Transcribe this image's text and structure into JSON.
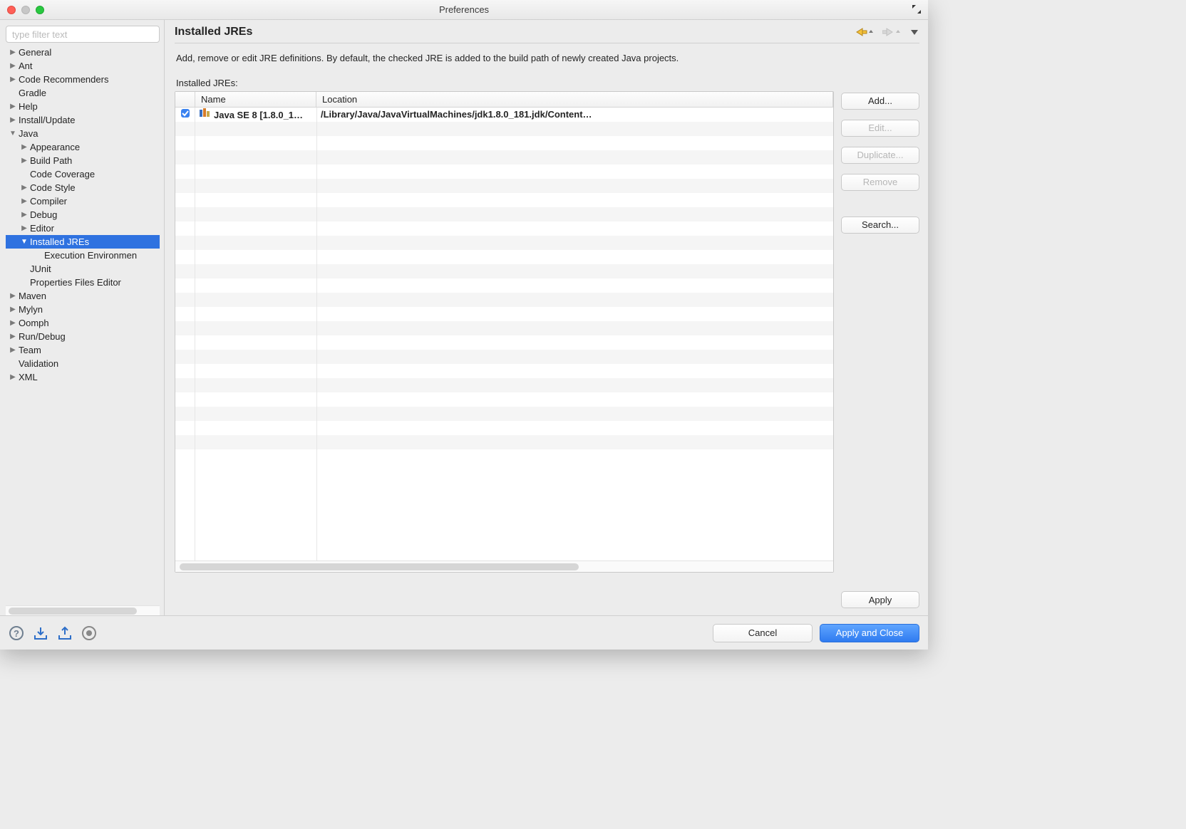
{
  "window": {
    "title": "Preferences"
  },
  "sidebar": {
    "filter_placeholder": "type filter text",
    "items": [
      {
        "label": "General",
        "exp": "▶",
        "indent": 0
      },
      {
        "label": "Ant",
        "exp": "▶",
        "indent": 0
      },
      {
        "label": "Code Recommenders",
        "exp": "▶",
        "indent": 0
      },
      {
        "label": "Gradle",
        "exp": "",
        "indent": 0
      },
      {
        "label": "Help",
        "exp": "▶",
        "indent": 0
      },
      {
        "label": "Install/Update",
        "exp": "▶",
        "indent": 0
      },
      {
        "label": "Java",
        "exp": "▼",
        "indent": 0
      },
      {
        "label": "Appearance",
        "exp": "▶",
        "indent": 1
      },
      {
        "label": "Build Path",
        "exp": "▶",
        "indent": 1
      },
      {
        "label": "Code Coverage",
        "exp": "",
        "indent": 1
      },
      {
        "label": "Code Style",
        "exp": "▶",
        "indent": 1
      },
      {
        "label": "Compiler",
        "exp": "▶",
        "indent": 1
      },
      {
        "label": "Debug",
        "exp": "▶",
        "indent": 1
      },
      {
        "label": "Editor",
        "exp": "▶",
        "indent": 1
      },
      {
        "label": "Installed JREs",
        "exp": "▼",
        "indent": 1,
        "selected": true
      },
      {
        "label": "Execution Environmen",
        "exp": "",
        "indent": 2
      },
      {
        "label": "JUnit",
        "exp": "",
        "indent": 1
      },
      {
        "label": "Properties Files Editor",
        "exp": "",
        "indent": 1
      },
      {
        "label": "Maven",
        "exp": "▶",
        "indent": 0
      },
      {
        "label": "Mylyn",
        "exp": "▶",
        "indent": 0
      },
      {
        "label": "Oomph",
        "exp": "▶",
        "indent": 0
      },
      {
        "label": "Run/Debug",
        "exp": "▶",
        "indent": 0
      },
      {
        "label": "Team",
        "exp": "▶",
        "indent": 0
      },
      {
        "label": "Validation",
        "exp": "",
        "indent": 0
      },
      {
        "label": "XML",
        "exp": "▶",
        "indent": 0
      }
    ]
  },
  "page": {
    "title": "Installed JREs",
    "description": "Add, remove or edit JRE definitions. By default, the checked JRE is added to the build path of newly created Java projects.",
    "table_label": "Installed JREs:",
    "columns": {
      "name": "Name",
      "location": "Location"
    },
    "rows": [
      {
        "checked": true,
        "name": "Java SE 8 [1.8.0_1…",
        "location": "/Library/Java/JavaVirtualMachines/jdk1.8.0_181.jdk/Content…"
      }
    ],
    "buttons": {
      "add": "Add...",
      "edit": "Edit...",
      "duplicate": "Duplicate...",
      "remove": "Remove",
      "search": "Search..."
    },
    "apply": "Apply"
  },
  "footer": {
    "cancel": "Cancel",
    "apply_close": "Apply and Close"
  }
}
